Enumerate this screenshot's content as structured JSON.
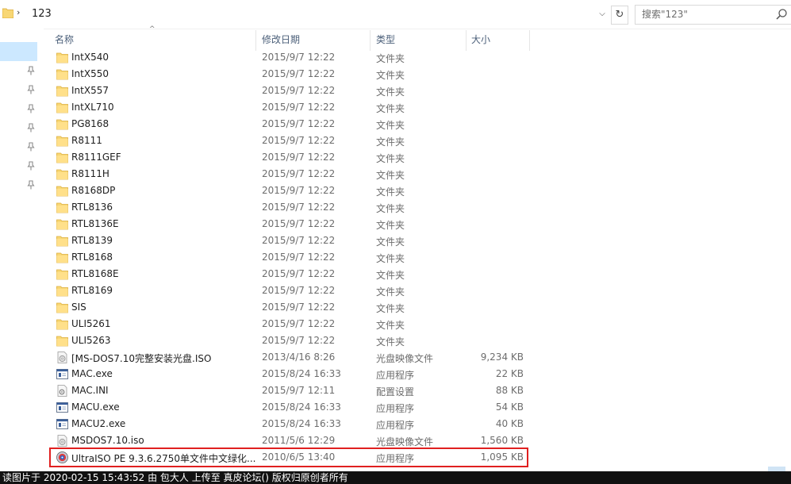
{
  "address": {
    "path": "123"
  },
  "search": {
    "placeholder": "搜索\"123\""
  },
  "columns": {
    "name": "名称",
    "date": "修改日期",
    "type": "类型",
    "size": "大小"
  },
  "files": [
    {
      "name": "IntX540",
      "date": "2015/9/7 12:22",
      "type": "文件夹",
      "size": "",
      "icon": "folder-icon"
    },
    {
      "name": "IntX550",
      "date": "2015/9/7 12:22",
      "type": "文件夹",
      "size": "",
      "icon": "folder-icon"
    },
    {
      "name": "IntX557",
      "date": "2015/9/7 12:22",
      "type": "文件夹",
      "size": "",
      "icon": "folder-icon"
    },
    {
      "name": "IntXL710",
      "date": "2015/9/7 12:22",
      "type": "文件夹",
      "size": "",
      "icon": "folder-icon"
    },
    {
      "name": "PG8168",
      "date": "2015/9/7 12:22",
      "type": "文件夹",
      "size": "",
      "icon": "folder-icon"
    },
    {
      "name": "R8111",
      "date": "2015/9/7 12:22",
      "type": "文件夹",
      "size": "",
      "icon": "folder-icon"
    },
    {
      "name": "R8111GEF",
      "date": "2015/9/7 12:22",
      "type": "文件夹",
      "size": "",
      "icon": "folder-icon"
    },
    {
      "name": "R8111H",
      "date": "2015/9/7 12:22",
      "type": "文件夹",
      "size": "",
      "icon": "folder-icon"
    },
    {
      "name": "R8168DP",
      "date": "2015/9/7 12:22",
      "type": "文件夹",
      "size": "",
      "icon": "folder-icon"
    },
    {
      "name": "RTL8136",
      "date": "2015/9/7 12:22",
      "type": "文件夹",
      "size": "",
      "icon": "folder-icon"
    },
    {
      "name": "RTL8136E",
      "date": "2015/9/7 12:22",
      "type": "文件夹",
      "size": "",
      "icon": "folder-icon"
    },
    {
      "name": "RTL8139",
      "date": "2015/9/7 12:22",
      "type": "文件夹",
      "size": "",
      "icon": "folder-icon"
    },
    {
      "name": "RTL8168",
      "date": "2015/9/7 12:22",
      "type": "文件夹",
      "size": "",
      "icon": "folder-icon"
    },
    {
      "name": "RTL8168E",
      "date": "2015/9/7 12:22",
      "type": "文件夹",
      "size": "",
      "icon": "folder-icon"
    },
    {
      "name": "RTL8169",
      "date": "2015/9/7 12:22",
      "type": "文件夹",
      "size": "",
      "icon": "folder-icon"
    },
    {
      "name": "SIS",
      "date": "2015/9/7 12:22",
      "type": "文件夹",
      "size": "",
      "icon": "folder-icon"
    },
    {
      "name": "ULI5261",
      "date": "2015/9/7 12:22",
      "type": "文件夹",
      "size": "",
      "icon": "folder-icon"
    },
    {
      "name": "ULI5263",
      "date": "2015/9/7 12:22",
      "type": "文件夹",
      "size": "",
      "icon": "folder-icon"
    },
    {
      "name": "[MS-DOS7.10完整安装光盘.ISO",
      "date": "2013/4/16 8:26",
      "type": "光盘映像文件",
      "size": "9,234 KB",
      "icon": "disc-image-icon"
    },
    {
      "name": "MAC.exe",
      "date": "2015/8/24 16:33",
      "type": "应用程序",
      "size": "22 KB",
      "icon": "exe-icon"
    },
    {
      "name": "MAC.INI",
      "date": "2015/9/7 12:11",
      "type": "配置设置",
      "size": "88 KB",
      "icon": "ini-icon"
    },
    {
      "name": "MACU.exe",
      "date": "2015/8/24 16:33",
      "type": "应用程序",
      "size": "54 KB",
      "icon": "exe-icon"
    },
    {
      "name": "MACU2.exe",
      "date": "2015/8/24 16:33",
      "type": "应用程序",
      "size": "40 KB",
      "icon": "exe-icon"
    },
    {
      "name": "MSDOS7.10.iso",
      "date": "2011/5/6 12:29",
      "type": "光盘映像文件",
      "size": "1,560 KB",
      "icon": "disc-image-icon"
    },
    {
      "name": "UltraISO PE 9.3.6.2750单文件中文绿化...",
      "date": "2010/6/5 13:40",
      "type": "应用程序",
      "size": "1,095 KB",
      "icon": "ultraiso-icon",
      "highlighted": true
    }
  ],
  "watermark": "读图片于 2020-02-15 15:43:52 由 包大人 上传至 真皮论坛() 版权归原创者所有",
  "colors": {
    "highlight_border": "#e02020",
    "folder": "#f8d775",
    "selected_nav": "#cce8ff"
  }
}
